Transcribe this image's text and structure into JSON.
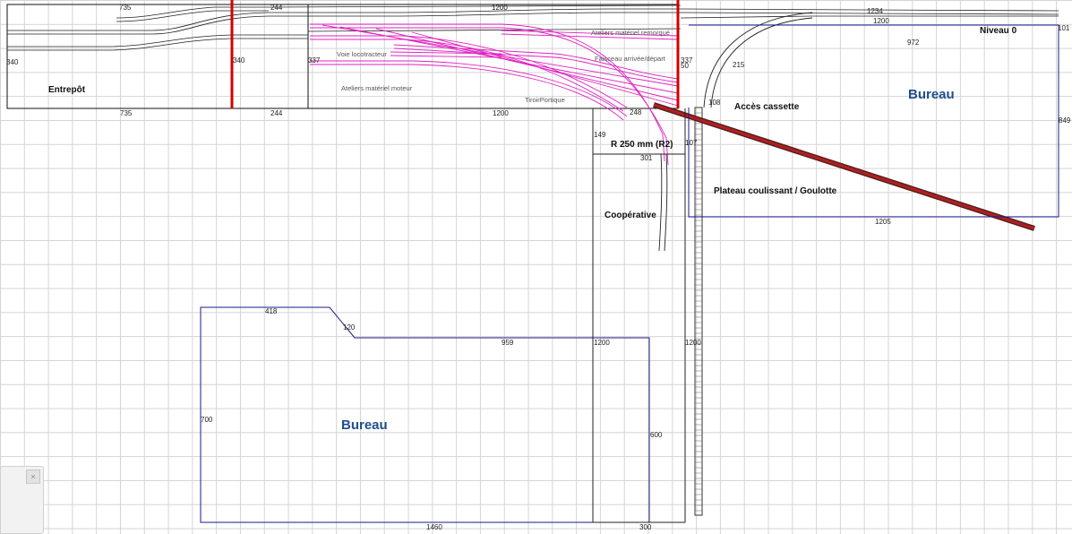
{
  "zones": {
    "entrepot": "Entrepôt",
    "niveau0": "Niveau 0",
    "acces_cassette": "Accès cassette",
    "r250": "R 250 mm (R2)",
    "plateau": "Plateau coulissant / Goulotte",
    "cooperative": "Coopérative",
    "bureau_top": "Bureau",
    "bureau_bottom": "Bureau"
  },
  "track_labels": {
    "voie_locotracteur": "Voie locotracteur",
    "ateliers_moteur": "Ateliers matériel moteur",
    "ateliers_remorque": "Ateliers matériel remorqué",
    "faisceau": "Faisceau arrivée/départ",
    "tiroir": "TiroirPortique"
  },
  "dimensions": {
    "top_735": "735",
    "top_244": "244",
    "top_1200": "1200",
    "top_1234": "1234",
    "top_1200b": "1200",
    "top_101": "101",
    "d_972": "972",
    "d_340": "340",
    "d_340b": "340",
    "d_337": "337",
    "d_337b": "337",
    "d_50": "50",
    "d_215": "215",
    "d_108": "108",
    "d_849": "849",
    "bot_735": "735",
    "bot_244": "244",
    "bot_1200": "1200",
    "d_248": "248",
    "d_149": "149",
    "d_107": "107",
    "d_301": "301",
    "d_1205": "1205",
    "d_418": "418",
    "d_120": "120",
    "d_959": "959",
    "d_1200c": "1200",
    "d_1200d": "1200",
    "d_700": "700",
    "d_600": "600",
    "d_1460": "1460",
    "d_300": "300"
  },
  "colors": {
    "wall": "#1a1a8c",
    "track": "#222222",
    "pink_track": "#e020c0",
    "red_marker": "#d00000",
    "bureau_text": "#1f4e8c"
  },
  "ui": {
    "close_label": "×"
  }
}
